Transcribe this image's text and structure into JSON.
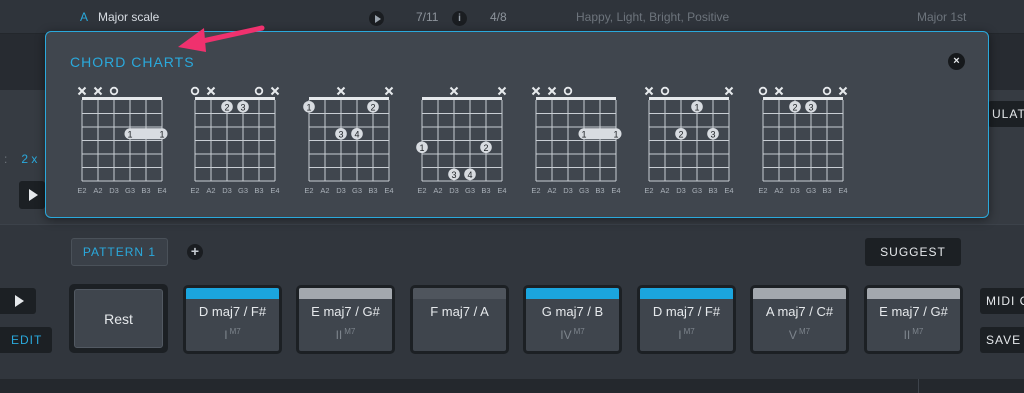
{
  "top_row": {
    "key": "A",
    "scale": "Major scale",
    "fraction_a": "7/11",
    "info": "i",
    "fraction_b": "4/8",
    "mood": "Happy, Light, Bright, Positive",
    "mode": "Major 1st"
  },
  "left": {
    "dim_text": ":",
    "number": "2 x"
  },
  "right_tag": "ULATI",
  "chord_charts": {
    "title": "CHORD CHARTS",
    "close": "×",
    "string_labels": [
      "E2",
      "A2",
      "D3",
      "G3",
      "B3",
      "E4"
    ],
    "charts": [
      {
        "strings": [
          "x",
          "x",
          "o",
          "",
          "",
          ""
        ],
        "dots": [
          {
            "fret": 3,
            "from": 4,
            "to": 6,
            "label": "1",
            "barre": true
          }
        ]
      },
      {
        "strings": [
          "o",
          "x",
          "",
          "",
          "o",
          "x"
        ],
        "dots": [
          {
            "fret": 1,
            "string": 3,
            "label": "2"
          },
          {
            "fret": 1,
            "string": 4,
            "label": "3"
          }
        ]
      },
      {
        "strings": [
          "",
          "",
          "x",
          "",
          "",
          "x"
        ],
        "dots": [
          {
            "fret": 1,
            "string": 1,
            "label": "1"
          },
          {
            "fret": 1,
            "string": 5,
            "label": "2"
          },
          {
            "fret": 3,
            "string": 3,
            "label": "3"
          },
          {
            "fret": 3,
            "string": 4,
            "label": "4"
          }
        ]
      },
      {
        "strings": [
          "",
          "",
          "x",
          "",
          "",
          "x"
        ],
        "dots": [
          {
            "fret": 4,
            "string": 1,
            "label": "1"
          },
          {
            "fret": 4,
            "string": 5,
            "label": "2"
          },
          {
            "fret": 6,
            "string": 3,
            "label": "3"
          },
          {
            "fret": 6,
            "string": 4,
            "label": "4"
          }
        ]
      },
      {
        "strings": [
          "x",
          "x",
          "o",
          "",
          "",
          ""
        ],
        "dots": [
          {
            "fret": 3,
            "from": 4,
            "to": 6,
            "label": "1",
            "barre": true
          }
        ]
      },
      {
        "strings": [
          "x",
          "o",
          "",
          "",
          "",
          "x"
        ],
        "dots": [
          {
            "fret": 1,
            "string": 4,
            "label": "1"
          },
          {
            "fret": 3,
            "string": 3,
            "label": "2"
          },
          {
            "fret": 3,
            "string": 5,
            "label": "3"
          }
        ]
      },
      {
        "strings": [
          "o",
          "x",
          "",
          "",
          "o",
          "x"
        ],
        "dots": [
          {
            "fret": 1,
            "string": 3,
            "label": "2"
          },
          {
            "fret": 1,
            "string": 4,
            "label": "3"
          }
        ]
      }
    ]
  },
  "pattern": {
    "label": "PATTERN 1",
    "add": "+"
  },
  "suggest_label": "SUGGEST",
  "transport": {
    "edit_label": "EDIT",
    "midi_label": "MIDI C",
    "save_label": "SAVE"
  },
  "rest_label": "Rest",
  "chords": [
    {
      "name": "D maj7 / F#",
      "roman": "I",
      "quality": "M7",
      "bar": "#1ba5de"
    },
    {
      "name": "E maj7 / G#",
      "roman": "II",
      "quality": "M7",
      "bar": "#a3a8ae"
    },
    {
      "name": "F maj7 / A",
      "roman": "",
      "quality": "",
      "bar": "#4f555d"
    },
    {
      "name": "G maj7 / B",
      "roman": "IV",
      "quality": "M7",
      "bar": "#1ba5de"
    },
    {
      "name": "D maj7 / F#",
      "roman": "I",
      "quality": "M7",
      "bar": "#1ba5de"
    },
    {
      "name": "A maj7 / C#",
      "roman": "V",
      "quality": "M7",
      "bar": "#a3a8ae"
    },
    {
      "name": "E maj7 / G#",
      "roman": "II",
      "quality": "M7",
      "bar": "#a3a8ae"
    }
  ],
  "colors": {
    "accent": "#2aa9dc",
    "pointer_arrow": "#f0316e"
  }
}
